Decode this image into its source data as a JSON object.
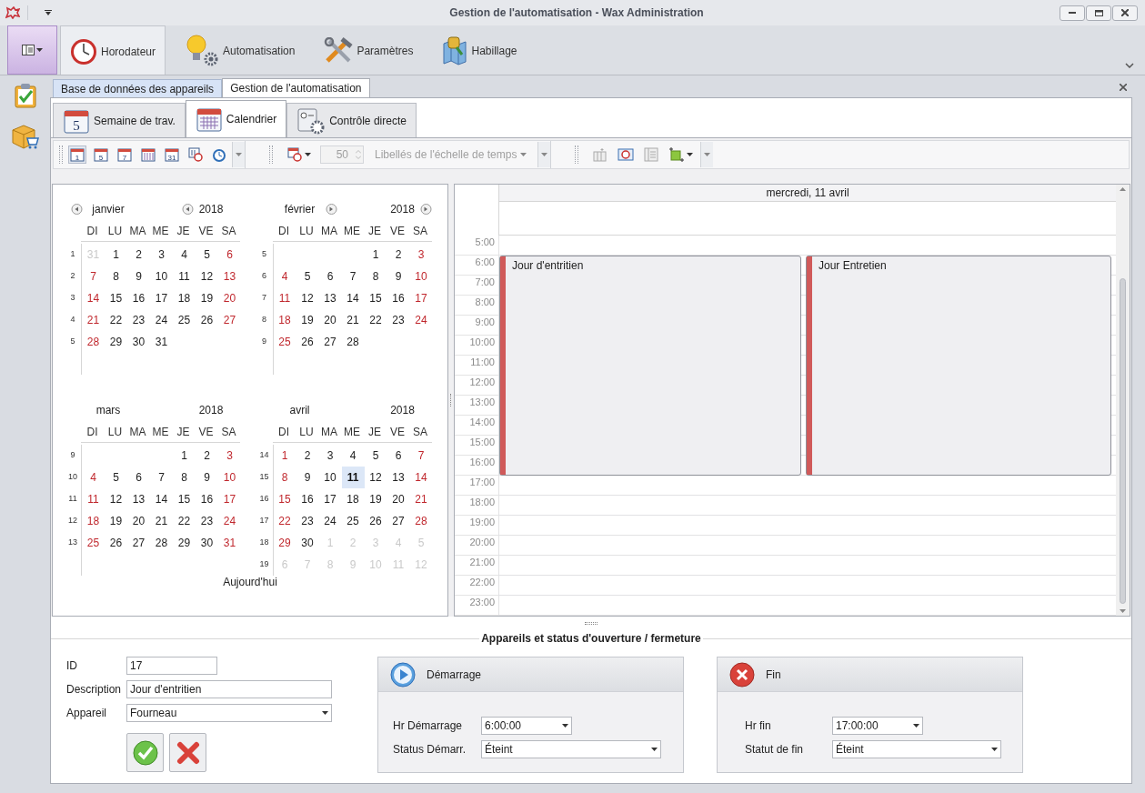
{
  "window": {
    "title": "Gestion de l'automatisation - Wax Administration"
  },
  "ribbon": {
    "tabs": [
      {
        "label": "Horodateur",
        "kind": "clock",
        "selected": true
      },
      {
        "label": "Automatisation",
        "kind": "bulb",
        "selected": false
      },
      {
        "label": "Paramètres",
        "kind": "tools",
        "selected": false
      },
      {
        "label": "Habillage",
        "kind": "map",
        "selected": false
      }
    ]
  },
  "document_tabs": [
    {
      "label": "Base de données des appareils",
      "selected": false
    },
    {
      "label": "Gestion de l'automatisation",
      "selected": true
    }
  ],
  "view_tabs": [
    {
      "label": "Semaine de trav.",
      "kind": "week",
      "icon_text": "5",
      "selected": false
    },
    {
      "label": "Calendrier",
      "kind": "calendar",
      "selected": true
    },
    {
      "label": "Contrôle directe",
      "kind": "control",
      "selected": false
    }
  ],
  "toolbar": {
    "view_buttons": [
      {
        "kind": "number",
        "text": "1",
        "selected": true
      },
      {
        "kind": "number",
        "text": "5",
        "selected": false
      },
      {
        "kind": "number",
        "text": "7",
        "selected": false
      },
      {
        "kind": "grid",
        "selected": false
      },
      {
        "kind": "number",
        "text": "31",
        "selected": false
      },
      {
        "kind": "timeline",
        "selected": false
      },
      {
        "kind": "clock",
        "selected": false
      }
    ],
    "spin": {
      "value": "50",
      "disabled": true
    },
    "scale_labels": {
      "label": "Libellés de l'échelle de temps",
      "disabled": true
    }
  },
  "date_navigator": {
    "months": [
      {
        "name": "janvier",
        "year": "2018",
        "prev_arrow": true,
        "next_arrow": false,
        "weekdays": [
          "DI",
          "LU",
          "MA",
          "ME",
          "JE",
          "VE",
          "SA"
        ],
        "weeks": [
          {
            "number": "1",
            "days": [
              {
                "text": "31",
                "kind": "other"
              },
              {
                "text": "1",
                "kind": "day"
              },
              {
                "text": "2",
                "kind": "day"
              },
              {
                "text": "3",
                "kind": "day"
              },
              {
                "text": "4",
                "kind": "day"
              },
              {
                "text": "5",
                "kind": "day"
              },
              {
                "text": "6",
                "kind": "weekend"
              }
            ]
          },
          {
            "number": "2",
            "days": [
              {
                "text": "7",
                "kind": "weekend"
              },
              {
                "text": "8",
                "kind": "day"
              },
              {
                "text": "9",
                "kind": "day"
              },
              {
                "text": "10",
                "kind": "day"
              },
              {
                "text": "11",
                "kind": "day"
              },
              {
                "text": "12",
                "kind": "day"
              },
              {
                "text": "13",
                "kind": "weekend"
              }
            ]
          },
          {
            "number": "3",
            "days": [
              {
                "text": "14",
                "kind": "weekend"
              },
              {
                "text": "15",
                "kind": "day"
              },
              {
                "text": "16",
                "kind": "day"
              },
              {
                "text": "17",
                "kind": "day"
              },
              {
                "text": "18",
                "kind": "day"
              },
              {
                "text": "19",
                "kind": "day"
              },
              {
                "text": "20",
                "kind": "weekend"
              }
            ]
          },
          {
            "number": "4",
            "days": [
              {
                "text": "21",
                "kind": "weekend"
              },
              {
                "text": "22",
                "kind": "day"
              },
              {
                "text": "23",
                "kind": "day"
              },
              {
                "text": "24",
                "kind": "day"
              },
              {
                "text": "25",
                "kind": "day"
              },
              {
                "text": "26",
                "kind": "day"
              },
              {
                "text": "27",
                "kind": "weekend"
              }
            ]
          },
          {
            "number": "5",
            "days": [
              {
                "text": "28",
                "kind": "weekend"
              },
              {
                "text": "29",
                "kind": "day"
              },
              {
                "text": "30",
                "kind": "day"
              },
              {
                "text": "31",
                "kind": "day"
              }
            ]
          }
        ]
      },
      {
        "name": "février",
        "year": "2018",
        "prev_arrow": false,
        "next_arrow": true,
        "weekdays": [
          "DI",
          "LU",
          "MA",
          "ME",
          "JE",
          "VE",
          "SA"
        ],
        "weeks": [
          {
            "number": "5",
            "days": [
              {
                "kind": "blank"
              },
              {
                "kind": "blank"
              },
              {
                "kind": "blank"
              },
              {
                "kind": "blank"
              },
              {
                "text": "1",
                "kind": "day"
              },
              {
                "text": "2",
                "kind": "day"
              },
              {
                "text": "3",
                "kind": "weekend"
              }
            ]
          },
          {
            "number": "6",
            "days": [
              {
                "text": "4",
                "kind": "weekend"
              },
              {
                "text": "5",
                "kind": "day"
              },
              {
                "text": "6",
                "kind": "day"
              },
              {
                "text": "7",
                "kind": "day"
              },
              {
                "text": "8",
                "kind": "day"
              },
              {
                "text": "9",
                "kind": "day"
              },
              {
                "text": "10",
                "kind": "weekend"
              }
            ]
          },
          {
            "number": "7",
            "days": [
              {
                "text": "11",
                "kind": "weekend"
              },
              {
                "text": "12",
                "kind": "day"
              },
              {
                "text": "13",
                "kind": "day"
              },
              {
                "text": "14",
                "kind": "day"
              },
              {
                "text": "15",
                "kind": "day"
              },
              {
                "text": "16",
                "kind": "day"
              },
              {
                "text": "17",
                "kind": "weekend"
              }
            ]
          },
          {
            "number": "8",
            "days": [
              {
                "text": "18",
                "kind": "weekend"
              },
              {
                "text": "19",
                "kind": "day"
              },
              {
                "text": "20",
                "kind": "day"
              },
              {
                "text": "21",
                "kind": "day"
              },
              {
                "text": "22",
                "kind": "day"
              },
              {
                "text": "23",
                "kind": "day"
              },
              {
                "text": "24",
                "kind": "weekend"
              }
            ]
          },
          {
            "number": "9",
            "days": [
              {
                "text": "25",
                "kind": "weekend"
              },
              {
                "text": "26",
                "kind": "day"
              },
              {
                "text": "27",
                "kind": "day"
              },
              {
                "text": "28",
                "kind": "day"
              }
            ]
          }
        ]
      },
      {
        "name": "mars",
        "year": "2018",
        "prev_arrow": false,
        "next_arrow": false,
        "weekdays": [
          "DI",
          "LU",
          "MA",
          "ME",
          "JE",
          "VE",
          "SA"
        ],
        "weeks": [
          {
            "number": "9",
            "days": [
              {
                "kind": "blank"
              },
              {
                "kind": "blank"
              },
              {
                "kind": "blank"
              },
              {
                "kind": "blank"
              },
              {
                "text": "1",
                "kind": "day"
              },
              {
                "text": "2",
                "kind": "day"
              },
              {
                "text": "3",
                "kind": "weekend"
              }
            ]
          },
          {
            "number": "10",
            "days": [
              {
                "text": "4",
                "kind": "weekend"
              },
              {
                "text": "5",
                "kind": "day"
              },
              {
                "text": "6",
                "kind": "day"
              },
              {
                "text": "7",
                "kind": "day"
              },
              {
                "text": "8",
                "kind": "day"
              },
              {
                "text": "9",
                "kind": "day"
              },
              {
                "text": "10",
                "kind": "weekend"
              }
            ]
          },
          {
            "number": "11",
            "days": [
              {
                "text": "11",
                "kind": "weekend"
              },
              {
                "text": "12",
                "kind": "day"
              },
              {
                "text": "13",
                "kind": "day"
              },
              {
                "text": "14",
                "kind": "day"
              },
              {
                "text": "15",
                "kind": "day"
              },
              {
                "text": "16",
                "kind": "day"
              },
              {
                "text": "17",
                "kind": "weekend"
              }
            ]
          },
          {
            "number": "12",
            "days": [
              {
                "text": "18",
                "kind": "weekend"
              },
              {
                "text": "19",
                "kind": "day"
              },
              {
                "text": "20",
                "kind": "day"
              },
              {
                "text": "21",
                "kind": "day"
              },
              {
                "text": "22",
                "kind": "day"
              },
              {
                "text": "23",
                "kind": "day"
              },
              {
                "text": "24",
                "kind": "weekend"
              }
            ]
          },
          {
            "number": "13",
            "days": [
              {
                "text": "25",
                "kind": "weekend"
              },
              {
                "text": "26",
                "kind": "day"
              },
              {
                "text": "27",
                "kind": "day"
              },
              {
                "text": "28",
                "kind": "day"
              },
              {
                "text": "29",
                "kind": "day"
              },
              {
                "text": "30",
                "kind": "day"
              },
              {
                "text": "31",
                "kind": "weekend"
              }
            ]
          }
        ]
      },
      {
        "name": "avril",
        "year": "2018",
        "prev_arrow": false,
        "next_arrow": false,
        "weekdays": [
          "DI",
          "LU",
          "MA",
          "ME",
          "JE",
          "VE",
          "SA"
        ],
        "weeks": [
          {
            "number": "14",
            "days": [
              {
                "text": "1",
                "kind": "weekend"
              },
              {
                "text": "2",
                "kind": "day"
              },
              {
                "text": "3",
                "kind": "day"
              },
              {
                "text": "4",
                "kind": "day"
              },
              {
                "text": "5",
                "kind": "day"
              },
              {
                "text": "6",
                "kind": "day"
              },
              {
                "text": "7",
                "kind": "weekend"
              }
            ]
          },
          {
            "number": "15",
            "days": [
              {
                "text": "8",
                "kind": "weekend"
              },
              {
                "text": "9",
                "kind": "day"
              },
              {
                "text": "10",
                "kind": "day"
              },
              {
                "text": "11",
                "kind": "today"
              },
              {
                "text": "12",
                "kind": "day"
              },
              {
                "text": "13",
                "kind": "day"
              },
              {
                "text": "14",
                "kind": "weekend"
              }
            ]
          },
          {
            "number": "16",
            "days": [
              {
                "text": "15",
                "kind": "weekend"
              },
              {
                "text": "16",
                "kind": "day"
              },
              {
                "text": "17",
                "kind": "day"
              },
              {
                "text": "18",
                "kind": "day"
              },
              {
                "text": "19",
                "kind": "day"
              },
              {
                "text": "20",
                "kind": "day"
              },
              {
                "text": "21",
                "kind": "weekend"
              }
            ]
          },
          {
            "number": "17",
            "days": [
              {
                "text": "22",
                "kind": "weekend"
              },
              {
                "text": "23",
                "kind": "day"
              },
              {
                "text": "24",
                "kind": "day"
              },
              {
                "text": "25",
                "kind": "day"
              },
              {
                "text": "26",
                "kind": "day"
              },
              {
                "text": "27",
                "kind": "day"
              },
              {
                "text": "28",
                "kind": "weekend"
              }
            ]
          },
          {
            "number": "18",
            "days": [
              {
                "text": "29",
                "kind": "weekend"
              },
              {
                "text": "30",
                "kind": "day"
              },
              {
                "text": "1",
                "kind": "other"
              },
              {
                "text": "2",
                "kind": "other"
              },
              {
                "text": "3",
                "kind": "other"
              },
              {
                "text": "4",
                "kind": "other"
              },
              {
                "text": "5",
                "kind": "other"
              }
            ]
          },
          {
            "number": "19",
            "days": [
              {
                "text": "6",
                "kind": "other"
              },
              {
                "text": "7",
                "kind": "other"
              },
              {
                "text": "8",
                "kind": "other"
              },
              {
                "text": "9",
                "kind": "other"
              },
              {
                "text": "10",
                "kind": "other"
              },
              {
                "text": "11",
                "kind": "other"
              },
              {
                "text": "12",
                "kind": "other"
              }
            ]
          }
        ]
      }
    ],
    "today_button": "Aujourd'hui"
  },
  "scheduler": {
    "day_header": "mercredi, 11 avril",
    "times": [
      "5:00",
      "6:00",
      "7:00",
      "8:00",
      "9:00",
      "10:00",
      "11:00",
      "12:00",
      "13:00",
      "14:00",
      "15:00",
      "16:00",
      "17:00",
      "18:00",
      "19:00",
      "20:00",
      "21:00",
      "22:00",
      "23:00"
    ],
    "appointments": [
      {
        "title": "Jour d'entritien"
      },
      {
        "title": "Jour Entretien"
      }
    ]
  },
  "details": {
    "title": "Appareils et status d'ouverture / fermeture",
    "fields": [
      {
        "label": "ID",
        "value": "17",
        "kind": "text"
      },
      {
        "label": "Description",
        "value": "Jour d'entritien",
        "kind": "text"
      },
      {
        "label": "Appareil",
        "value": "Fourneau",
        "kind": "dropdown"
      }
    ],
    "groups": [
      {
        "title": "Démarrage",
        "kind": "start",
        "fields": [
          {
            "label": "Hr Démarrage",
            "value": "6:00:00"
          },
          {
            "label": "Status Démarr.",
            "value": "Éteint"
          }
        ]
      },
      {
        "title": "Fin",
        "kind": "end",
        "fields": [
          {
            "label": "Hr fin",
            "value": "17:00:00"
          },
          {
            "label": "Statut de fin",
            "value": "Éteint"
          }
        ]
      }
    ]
  }
}
